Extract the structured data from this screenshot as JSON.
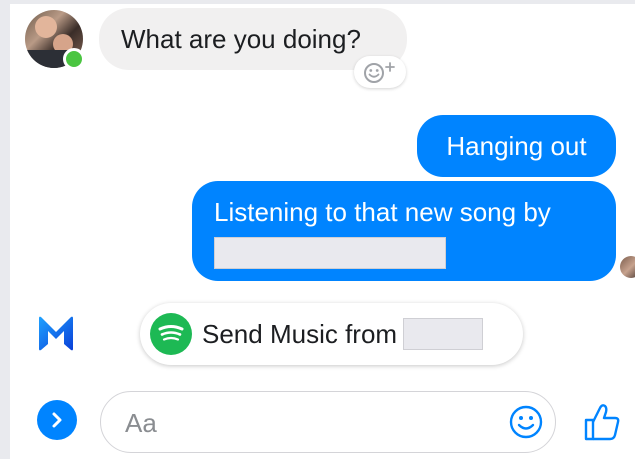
{
  "conversation": {
    "incoming": {
      "text": "What are you doing?",
      "sender_online": true
    },
    "outgoing": [
      {
        "text": "Hanging out"
      },
      {
        "text": "Listening to that new song by"
      }
    ]
  },
  "assistant_suggestion": {
    "label": "Send Music from",
    "service_icon": "spotify-icon"
  },
  "composer": {
    "placeholder": "Aa",
    "value": ""
  },
  "colors": {
    "accent": "#0084ff",
    "incoming_bubble": "#f1f0f0",
    "online": "#4bc541",
    "spotify": "#1db954"
  },
  "icons": {
    "react": "add-reaction-icon",
    "assistant": "messenger-m-icon",
    "expand": "chevron-right-icon",
    "emoji": "smiley-icon",
    "like": "thumbs-up-icon"
  }
}
